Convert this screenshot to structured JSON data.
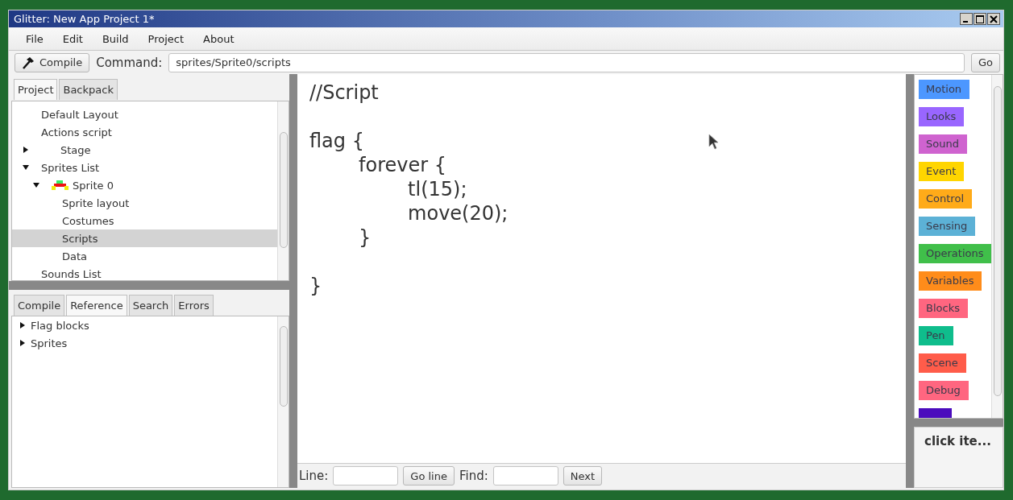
{
  "window": {
    "title": "Glitter: New App Project 1*"
  },
  "menu": [
    "File",
    "Edit",
    "Build",
    "Project",
    "About"
  ],
  "toolbar": {
    "compile_button": "Compile",
    "command_label": "Command:",
    "command_value": "sprites/Sprite0/scripts",
    "go_button": "Go"
  },
  "project_tabs": [
    {
      "label": "Project",
      "selected": true
    },
    {
      "label": "Backpack",
      "selected": false
    }
  ],
  "tree": [
    {
      "label": "Default Layout",
      "selected": false
    },
    {
      "label": "Actions script",
      "selected": false
    },
    {
      "label": "Stage",
      "selected": false,
      "expanded": false,
      "expandable": true
    },
    {
      "label": "Sprites List",
      "selected": false,
      "expanded": true,
      "children": [
        {
          "label": "Sprite 0",
          "selected": false,
          "expanded": true,
          "sprite": true,
          "children": [
            {
              "label": "Sprite layout",
              "selected": false
            },
            {
              "label": "Costumes",
              "selected": false
            },
            {
              "label": "Scripts",
              "selected": true
            },
            {
              "label": "Data",
              "selected": false
            }
          ]
        }
      ]
    },
    {
      "label": "Sounds List",
      "selected": false
    }
  ],
  "lower_tabs": [
    {
      "label": "Compile",
      "selected": false
    },
    {
      "label": "Reference",
      "selected": true
    },
    {
      "label": "Search",
      "selected": false
    },
    {
      "label": "Errors",
      "selected": false
    }
  ],
  "reference": [
    {
      "label": "Flag blocks",
      "expanded": false
    },
    {
      "label": "Sprites",
      "expanded": false
    }
  ],
  "editor": {
    "paragraphs": [
      [
        "//Script"
      ],
      [
        "flag {",
        "\tforever {",
        "\t\ttl(15);",
        "\t\tmove(20);",
        "\t}"
      ],
      [
        "}"
      ]
    ]
  },
  "editor_bar": {
    "line_label": "Line:",
    "go_line_button": "Go line",
    "find_label": "Find:",
    "next_button": "Next"
  },
  "palette": [
    {
      "label": "Motion",
      "color": "#4c97ff"
    },
    {
      "label": "Looks",
      "color": "#9966ff"
    },
    {
      "label": "Sound",
      "color": "#cf63cf"
    },
    {
      "label": "Event",
      "color": "#ffd500"
    },
    {
      "label": "Control",
      "color": "#ffab19"
    },
    {
      "label": "Sensing",
      "color": "#5cb1d6"
    },
    {
      "label": "Operations",
      "color": "#40bf4a"
    },
    {
      "label": "Variables",
      "color": "#ff8c1a"
    },
    {
      "label": "Blocks",
      "color": "#ff6680"
    },
    {
      "label": "Pen",
      "color": "#0fbd8c"
    },
    {
      "label": "Scene",
      "color": "#ff5c4a"
    },
    {
      "label": "Debug",
      "color": "#ff6680"
    },
    {
      "color": "#4b0cbd"
    }
  ],
  "hint": "click ite..."
}
